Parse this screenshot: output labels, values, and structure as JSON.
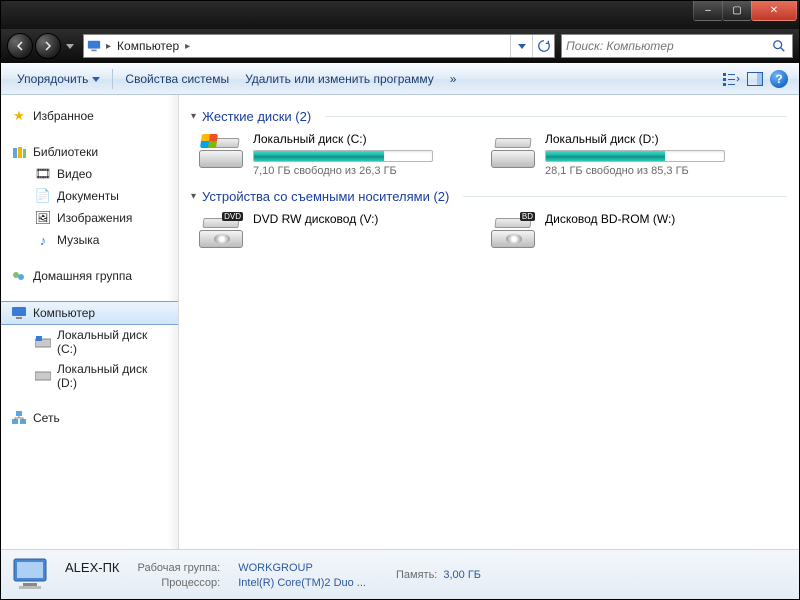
{
  "titlebar": {
    "minimize": "–",
    "maximize": "▢",
    "close": "✕"
  },
  "nav": {
    "crumbs": [
      "Компьютер"
    ],
    "search_placeholder": "Поиск: Компьютер"
  },
  "toolbar": {
    "organize": "Упорядочить",
    "properties": "Свойства системы",
    "uninstall": "Удалить или изменить программу",
    "overflow": "»"
  },
  "sidebar": {
    "favorites": "Избранное",
    "libraries": "Библиотеки",
    "lib_items": [
      "Видео",
      "Документы",
      "Изображения",
      "Музыка"
    ],
    "homegroup": "Домашняя группа",
    "computer": "Компьютер",
    "drives": [
      "Локальный диск (C:)",
      "Локальный диск (D:)"
    ],
    "network": "Сеть"
  },
  "main": {
    "hdd_header": "Жесткие диски (2)",
    "removable_header": "Устройства со съемными носителями (2)",
    "hdd": [
      {
        "name": "Локальный диск (C:)",
        "free_text": "7,10 ГБ свободно из 26,3 ГБ",
        "fill_pct": 73
      },
      {
        "name": "Локальный диск (D:)",
        "free_text": "28,1 ГБ свободно из 85,3 ГБ",
        "fill_pct": 67
      }
    ],
    "removable": [
      {
        "name": "DVD RW дисковод (V:)",
        "badge": "DVD"
      },
      {
        "name": "Дисковод BD-ROM (W:)",
        "badge": "BD"
      }
    ]
  },
  "details": {
    "pc_name": "ALEX-ПК",
    "workgroup_label": "Рабочая группа:",
    "workgroup": "WORKGROUP",
    "memory_label": "Память:",
    "memory": "3,00 ГБ",
    "cpu_label": "Процессор:",
    "cpu": "Intel(R) Core(TM)2 Duo ..."
  }
}
